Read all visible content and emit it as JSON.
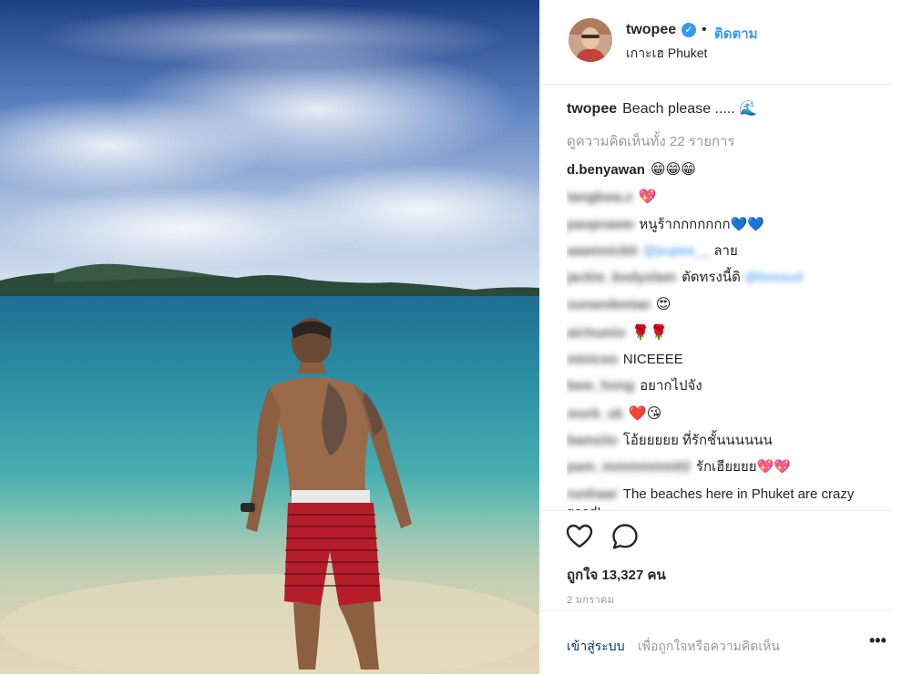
{
  "post": {
    "username": "twopee",
    "verified_icon": "verified-badge-icon",
    "separator": "•",
    "follow_label": "ติดตาม",
    "location": "เกาะเฮ Phuket"
  },
  "caption": {
    "username": "twopee",
    "text": "Beach please .....",
    "emoji": "🌊"
  },
  "view_all": "ดูความคิดเห็นทั้ง 22 รายการ",
  "comments": [
    {
      "user": "d.benyawan",
      "text": "😁😁😁",
      "blurred": false
    },
    {
      "user": "tangkwa.x",
      "text": "💖",
      "blurred": true
    },
    {
      "user": "paopraww",
      "text": "หนูร้ากกกกกกก💙💙",
      "blurred": true
    },
    {
      "user": "aaamnickit",
      "mention": "@pupee__",
      "text": "ลาย",
      "blurred": true
    },
    {
      "user": "jackie_bodyslam",
      "text": "ตัดทรงนี้ดิ",
      "mention": "@bossud",
      "blurred": true
    },
    {
      "user": "sunandeetae",
      "text": "😍",
      "blurred": true
    },
    {
      "user": "aichumix",
      "text": "🌹🌹",
      "blurred": true
    },
    {
      "user": "minicee",
      "text": "NICEEEE",
      "blurred": true
    },
    {
      "user": "bew_hong",
      "text": "อยากไปจัง",
      "blurred": true
    },
    {
      "user": "mork_sk",
      "text": "❤️😘",
      "blurred": true
    },
    {
      "user": "bamziio",
      "text": "โอ้ยยยยย ที่รักชั้นนนนนน",
      "blurred": true
    },
    {
      "user": "pam_mmmmmm02",
      "text": "รักเฮียยยย💖💖",
      "blurred": true
    },
    {
      "user": "runhaar",
      "text": "The beaches here in Phuket are crazy good!",
      "blurred": true
    }
  ],
  "actions": {
    "like_icon": "heart-icon",
    "comment_icon": "comment-bubble-icon",
    "likes_text": "ถูกใจ 13,327 คน",
    "date": "2 มกราคม"
  },
  "footer": {
    "login_label": "เข้าสู่ระบบ",
    "login_rest": "เพื่อถูกใจหรือความคิดเห็น",
    "more_label": "•••"
  },
  "colors": {
    "link": "#3897f0",
    "text": "#262626",
    "muted": "#999999",
    "border": "#efefef"
  }
}
